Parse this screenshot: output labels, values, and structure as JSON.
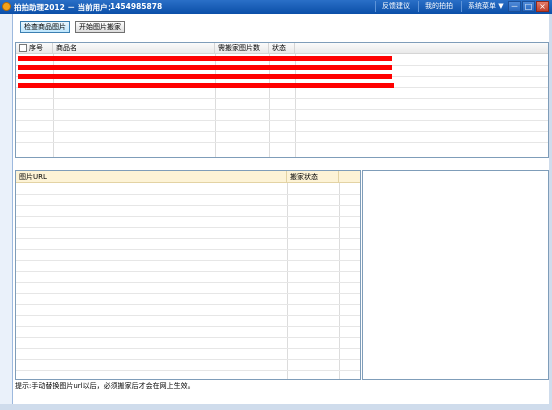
{
  "window": {
    "title": "拍拍助理2012 － 当前用户：",
    "user_id": "1454985878",
    "menu": [
      "反馈建议",
      "我的拍拍",
      "系统菜单 ▼"
    ],
    "controls": {
      "minimize": "－",
      "maximize": "□",
      "close": "×"
    }
  },
  "toolbar": {
    "check_label": "检查商品图片",
    "start_label": "开始图片搬家"
  },
  "product_table": {
    "columns": [
      "序号",
      "商品名",
      "需搬家图片数",
      "状态"
    ],
    "rows": 4
  },
  "url_table": {
    "columns": [
      "图片URL",
      "搬家状态"
    ]
  },
  "hint": "提示:手动替换图片url以后，必须搬家后才会在网上生效。",
  "colors": {
    "titlebar": "#0b4fa8",
    "row_highlight": "#ff0000",
    "url_header": "#fdf3d6"
  }
}
